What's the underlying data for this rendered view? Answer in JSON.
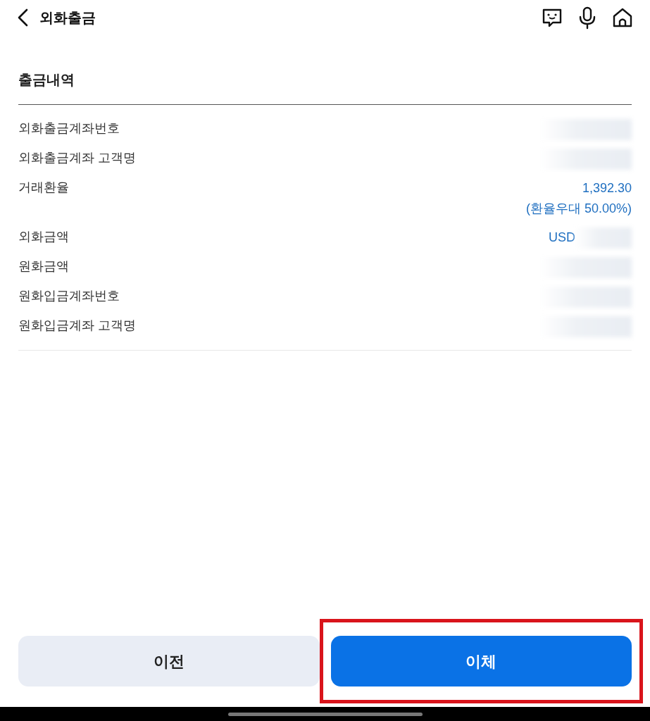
{
  "header": {
    "title": "외화출금"
  },
  "section": {
    "title": "출금내역"
  },
  "rows": [
    {
      "label": "외화출금계좌번호",
      "values": [],
      "redacted": true
    },
    {
      "label": "외화출금계좌 고객명",
      "values": [],
      "redacted": true
    },
    {
      "label": "거래환율",
      "values": [
        "1,392.30",
        "(환율우대 50.00%)"
      ],
      "redacted": false
    },
    {
      "label": "외화금액",
      "values": [
        "USD"
      ],
      "redacted": true
    },
    {
      "label": "원화금액",
      "values": [],
      "redacted": true
    },
    {
      "label": "원화입금계좌번호",
      "values": [],
      "redacted": true
    },
    {
      "label": "원화입금계좌 고객명",
      "values": [],
      "redacted": true
    }
  ],
  "buttons": [
    {
      "label": "이전",
      "kind": "secondary",
      "highlighted": false
    },
    {
      "label": "이체",
      "kind": "primary",
      "highlighted": true
    }
  ]
}
